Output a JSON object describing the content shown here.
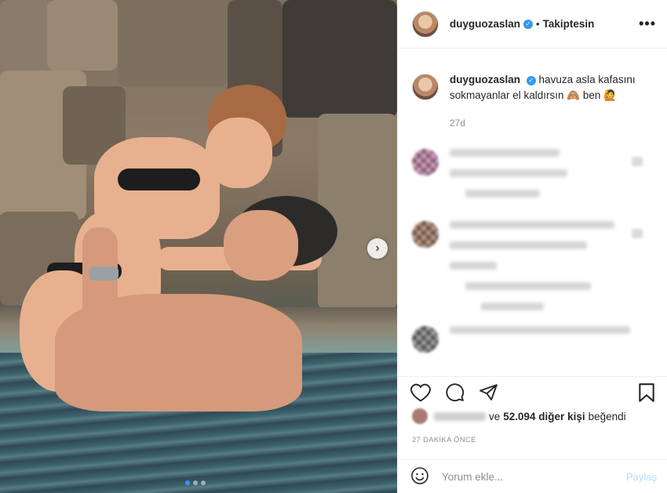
{
  "post": {
    "image_alt": "Photo of a couple in a pool",
    "carousel_active_index": 0,
    "carousel_count": 3
  },
  "header": {
    "username": "duyguozaslan",
    "separator": "•",
    "follow_label": "Takiptesin",
    "more_label": "•••",
    "verified_icon": "check"
  },
  "caption": {
    "username": "duyguozaslan",
    "text": "havuza asla kafasını sokmayanlar el kaldırsın 🙈 ben 🙋",
    "time_ago": "27d"
  },
  "likes": {
    "prefix": "ve",
    "count": "52.094 diğer kişi",
    "suffix": "beğendi"
  },
  "posted_time": "27 DAKİKA ÖNCE",
  "add_comment": {
    "placeholder": "Yorum ekle...",
    "post_label": "Paylaş"
  },
  "colors": {
    "accent": "#3897f0",
    "post_button_disabled": "#b2dffc",
    "muted_text": "#8e8e8e"
  },
  "icons": [
    "heart-icon",
    "comment-icon",
    "share-icon",
    "bookmark-icon",
    "emoji-icon",
    "chevron-right-icon",
    "more-icon"
  ]
}
